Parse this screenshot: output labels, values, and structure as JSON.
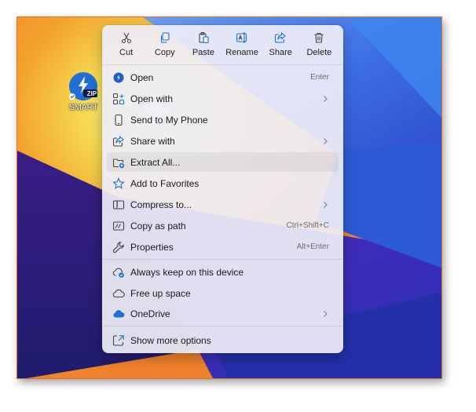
{
  "desktop": {
    "icon_badge": "ZIP",
    "icon_label": "SMART"
  },
  "colors": {
    "frame_border": "#e36d2c",
    "accent_blue": "#1f6fd6",
    "menu_background": "#eeedf6"
  },
  "toolbar": [
    {
      "label": "Cut",
      "icon": "scissors-icon"
    },
    {
      "label": "Copy",
      "icon": "copy-icon"
    },
    {
      "label": "Paste",
      "icon": "clipboard-icon"
    },
    {
      "label": "Rename",
      "icon": "rename-icon"
    },
    {
      "label": "Share",
      "icon": "share-icon"
    },
    {
      "label": "Delete",
      "icon": "trash-icon"
    }
  ],
  "menu": {
    "group1": [
      {
        "label": "Open",
        "shortcut": "Enter",
        "icon": "open-icon"
      },
      {
        "label": "Open with",
        "icon": "open-with-icon",
        "submenu": true
      },
      {
        "label": "Send to My Phone",
        "icon": "phone-icon"
      },
      {
        "label": "Share with",
        "icon": "share-with-icon",
        "submenu": true
      },
      {
        "label": "Extract All...",
        "icon": "extract-icon",
        "highlighted": true
      },
      {
        "label": "Add to Favorites",
        "icon": "star-icon"
      },
      {
        "label": "Compress to...",
        "icon": "compress-icon",
        "submenu": true
      },
      {
        "label": "Copy as path",
        "shortcut": "Ctrl+Shift+C",
        "icon": "path-icon"
      },
      {
        "label": "Properties",
        "shortcut": "Alt+Enter",
        "icon": "wrench-icon"
      }
    ],
    "group2": [
      {
        "label": "Always keep on this device",
        "icon": "cloud-keep-icon"
      },
      {
        "label": "Free up space",
        "icon": "cloud-outline-icon"
      },
      {
        "label": "OneDrive",
        "icon": "onedrive-icon",
        "submenu": true
      }
    ],
    "group3": [
      {
        "label": "Show more options",
        "icon": "more-options-icon"
      }
    ]
  }
}
